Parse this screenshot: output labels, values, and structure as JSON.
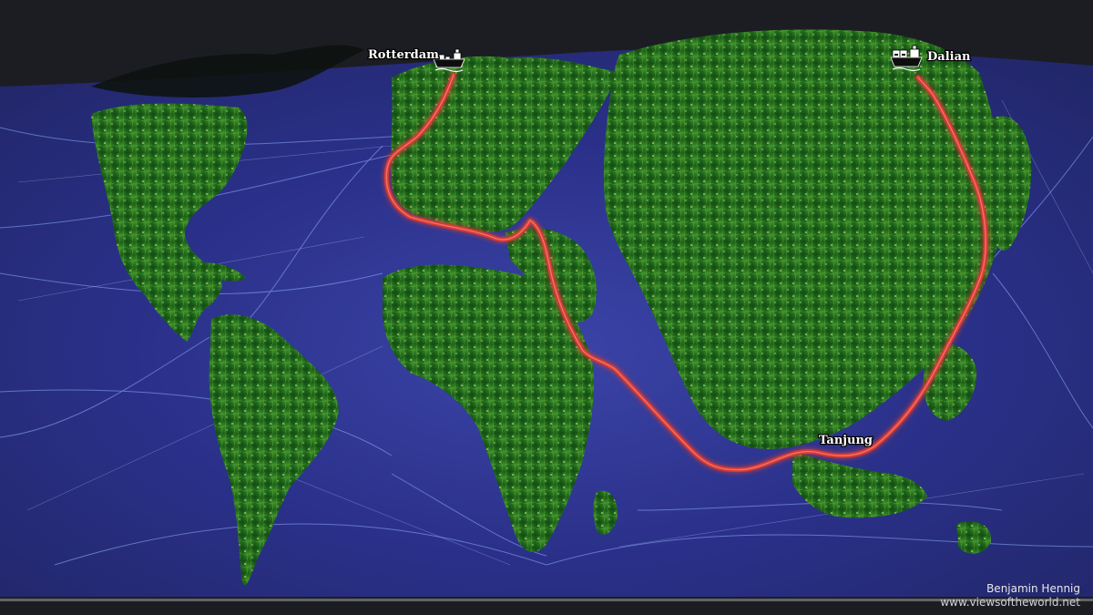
{
  "colors": {
    "background": "#1c1d22",
    "ocean": "#252a7a",
    "shipping_lanes": "#8fb0ff",
    "land": "#1f6d1c",
    "land_highlight": "#b9e36b",
    "route": "#d43a35",
    "label_text": "#ffffff"
  },
  "map": {
    "type": "cartogram of world population with global shipping lanes",
    "ports": [
      {
        "name": "Rotterdam",
        "icon": "container-ship-icon"
      },
      {
        "name": "Dalian",
        "icon": "container-ship-icon"
      },
      {
        "name": "Tanjung",
        "icon": "none"
      }
    ],
    "route": {
      "from": "Rotterdam",
      "via": "Tanjung",
      "to": "Dalian"
    }
  },
  "credit": {
    "author": "Benjamin Hennig",
    "website": "www.viewsoftheworld.net"
  }
}
